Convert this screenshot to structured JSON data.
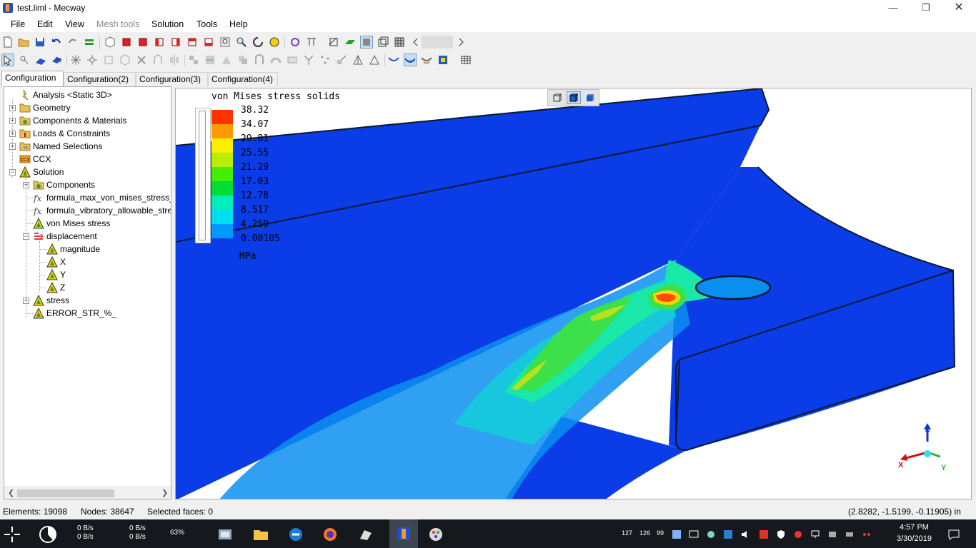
{
  "window": {
    "title": "test.liml - Mecway"
  },
  "menu": [
    "File",
    "Edit",
    "View",
    "Mesh tools",
    "Solution",
    "Tools",
    "Help"
  ],
  "menu_disabled": [
    "Mesh tools"
  ],
  "tabs": [
    "Configuration",
    "Configuration(2)",
    "Configuration(3)",
    "Configuration(4)"
  ],
  "tree": [
    {
      "label": "Analysis <Static 3D>",
      "icon": "analysis-icon",
      "level": 0
    },
    {
      "label": "Geometry",
      "icon": "folder-icon",
      "level": 0,
      "expandable": true
    },
    {
      "label": "Components & Materials",
      "icon": "components-icon",
      "level": 0,
      "expandable": true
    },
    {
      "label": "Loads & Constraints",
      "icon": "loads-icon",
      "level": 0,
      "expandable": true
    },
    {
      "label": "Named Selections",
      "icon": "named-selections-icon",
      "level": 0,
      "expandable": true
    },
    {
      "label": "CCX",
      "icon": "ccx-icon",
      "level": 0
    },
    {
      "label": "Solution",
      "icon": "solution-icon",
      "level": 0,
      "expanded": true
    },
    {
      "label": "Components",
      "icon": "components-icon",
      "level": 1,
      "expandable": true
    },
    {
      "label": "formula_max_von_mises_stress_",
      "icon": "formula-icon",
      "level": 1
    },
    {
      "label": "formula_vibratory_allowable_stre",
      "icon": "formula-icon",
      "level": 1
    },
    {
      "label": "von Mises stress",
      "icon": "result-icon",
      "level": 1
    },
    {
      "label": "displacement",
      "icon": "displacement-icon",
      "level": 1,
      "expanded": true
    },
    {
      "label": "magnitude",
      "icon": "result-icon",
      "level": 2
    },
    {
      "label": "X",
      "icon": "result-icon",
      "level": 2
    },
    {
      "label": "Y",
      "icon": "result-icon",
      "level": 2
    },
    {
      "label": "Z",
      "icon": "result-icon",
      "level": 2
    },
    {
      "label": "stress",
      "icon": "result-icon",
      "level": 1,
      "expandable": true
    },
    {
      "label": "ERROR_STR_%_",
      "icon": "result-icon",
      "level": 1
    }
  ],
  "legend": {
    "title": "von Mises stress solids",
    "values": [
      "38.32",
      "34.07",
      "29.81",
      "25.55",
      "21.29",
      "17.03",
      "12.78",
      "8.517",
      "4.259",
      "0.00105"
    ],
    "colors": [
      "#ff3300",
      "#ff9900",
      "#ffee00",
      "#bbee00",
      "#44ee00",
      "#00dd33",
      "#00eebb",
      "#00ddee",
      "#0099ff",
      "#0040ff"
    ],
    "units": "MPa"
  },
  "triad": {
    "x": "X",
    "y": "Y",
    "z": "Z"
  },
  "status": {
    "elements": "Elements: 19098",
    "nodes": "Nodes: 38647",
    "selected": "Selected faces: 0",
    "coords": "(2.8282, -1.5199, -0.11905) in"
  },
  "taskbar": {
    "net_up_1": "0 B/s",
    "net_down_1": "0 B/s",
    "net_up_2": "0 B/s",
    "net_down_2": "0 B/s",
    "cpu": "63%",
    "tray_nums": [
      "127",
      "126",
      "99"
    ],
    "time": "4:57 PM",
    "date": "3/30/2019"
  }
}
